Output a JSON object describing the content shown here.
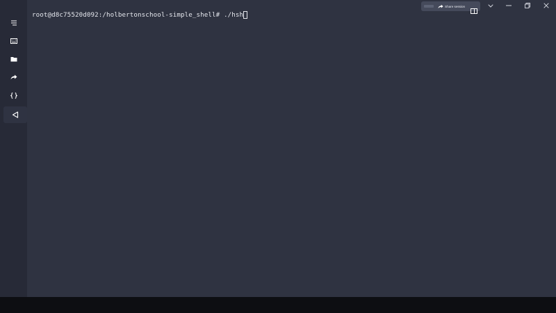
{
  "terminal": {
    "prompt": "root@d8c75520d092:/holbertonschool-simple_shell#",
    "command": " ./hsh"
  },
  "toolbar": {
    "share_label": "Share session"
  },
  "sidebar": {
    "items": [
      {
        "icon": "menu-icon"
      },
      {
        "icon": "keyboard-icon"
      },
      {
        "icon": "folder-icon"
      },
      {
        "icon": "forward-arrow-icon"
      },
      {
        "icon": "braces-icon"
      },
      {
        "icon": "play-triangle-icon"
      }
    ]
  },
  "colors": {
    "background": "#2f3341",
    "sidebar": "#272a37",
    "text": "#e6e8ee"
  }
}
